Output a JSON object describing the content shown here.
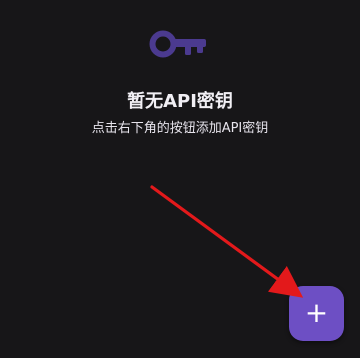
{
  "empty_state": {
    "icon": "key-icon",
    "title": "暂无API密钥",
    "subtitle": "点击右下角的按钮添加API密钥"
  },
  "fab": {
    "icon": "plus-icon",
    "label": "+"
  },
  "colors": {
    "background": "#171618",
    "accent": "#6d4fc4",
    "key_icon": "#4b3a8f",
    "annotation_arrow": "#e3191b"
  }
}
